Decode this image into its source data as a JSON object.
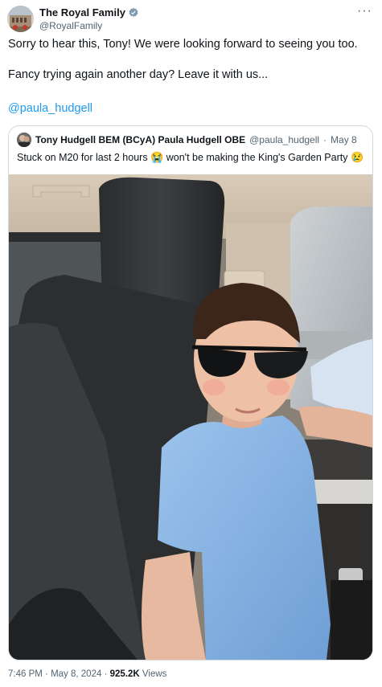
{
  "post": {
    "author_name": "The Royal Family",
    "author_handle": "@RoyalFamily",
    "more_label": "···",
    "text_line1": "Sorry to hear this, Tony! We were looking forward to seeing you too.",
    "text_line2": "Fancy trying again another day? Leave it with us...",
    "mention": "@paula_hudgell"
  },
  "quote": {
    "author_name": "Tony Hudgell BEM (BCyA) Paula Hudgell OBE",
    "author_handle": "@paula_hudgell",
    "separator": "·",
    "date": "May 8",
    "text": "Stuck on M20 for last 2 hours",
    "emoji1": "😭",
    "text2": "won't be making the King's Garden Party",
    "emoji2": "😢"
  },
  "footer": {
    "time": "7:46 PM",
    "separator": "·",
    "date": "May 8, 2024",
    "views_count": "925.2K",
    "views_label": "Views"
  },
  "colors": {
    "link": "#1d9bf0",
    "verified": "#829aab",
    "muted": "#536471"
  },
  "icons": {
    "verified": "verified-badge-icon",
    "more": "more-options-icon"
  }
}
